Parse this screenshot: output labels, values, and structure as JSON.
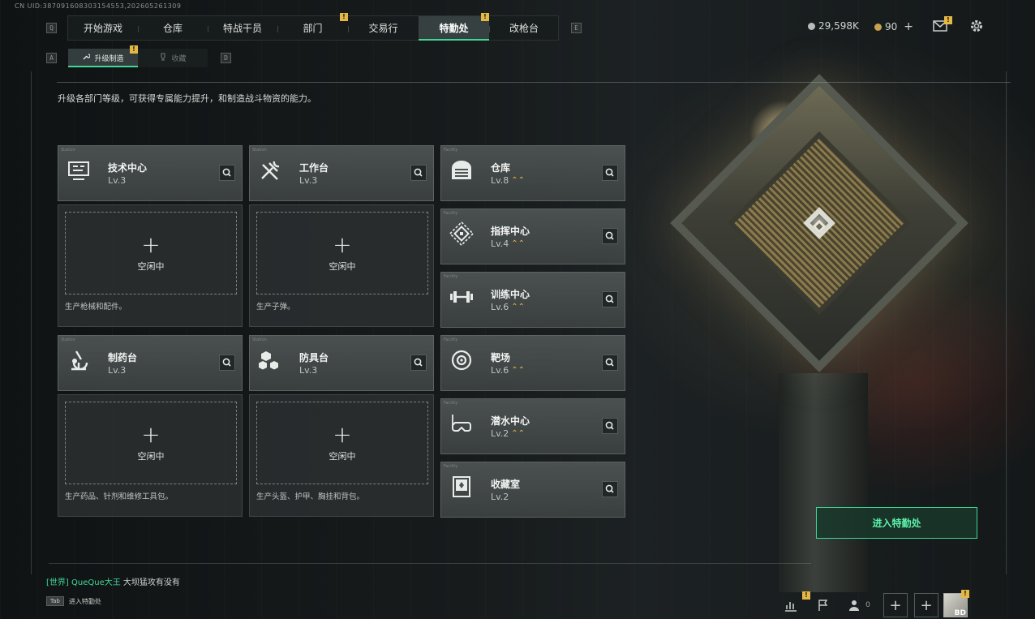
{
  "uid_text": "CN UID:387091608303154553,202605261309",
  "nav": {
    "key_left": "Q",
    "key_right": "E",
    "items": [
      {
        "label": "开始游戏",
        "badge": ""
      },
      {
        "label": "仓库",
        "badge": ""
      },
      {
        "label": "特战干员",
        "badge": ""
      },
      {
        "label": "部门",
        "badge": "!"
      },
      {
        "label": "交易行",
        "badge": ""
      },
      {
        "label": "特勤处",
        "badge": "!",
        "active": true
      },
      {
        "label": "改枪台",
        "badge": ""
      }
    ]
  },
  "resources": {
    "currency": "29,598K",
    "tokens": "90",
    "add": "+"
  },
  "header_icons": {
    "mail_badge": "!"
  },
  "subtabs": {
    "key_left": "A",
    "key_right": "D",
    "items": [
      {
        "label": "升级制造",
        "badge": "!",
        "icon": "wrench-icon"
      },
      {
        "label": "收藏",
        "badge": "",
        "icon": "trophy-icon"
      }
    ]
  },
  "description": "升级各部门等级，可获得专属能力提升，和制造战斗物资的能力。",
  "production": [
    {
      "name": "技术中心",
      "level": "Lv.3",
      "icon": "circuit-board-icon",
      "idle": "空闲中",
      "plus": "+",
      "desc": "生产枪械和配件。",
      "tiny": "Station"
    },
    {
      "name": "工作台",
      "level": "Lv.3",
      "icon": "tools-icon",
      "idle": "空闲中",
      "plus": "+",
      "desc": "生产子弹。",
      "tiny": "Station"
    },
    {
      "name": "制药台",
      "level": "Lv.3",
      "icon": "microscope-icon",
      "idle": "空闲中",
      "plus": "+",
      "desc": "生产药品、针剂和维修工具包。",
      "tiny": "Station"
    },
    {
      "name": "防具台",
      "level": "Lv.3",
      "icon": "armor-blocks-icon",
      "idle": "空闲中",
      "plus": "+",
      "desc": "生产头盔、护甲、胸挂和背包。",
      "tiny": "Station"
    }
  ],
  "facilities": [
    {
      "name": "仓库",
      "level": "Lv.8",
      "icon": "garage-icon",
      "upgrade": true,
      "tiny": "Facility"
    },
    {
      "name": "指挥中心",
      "level": "Lv.4",
      "icon": "command-chip-icon",
      "upgrade": true,
      "tiny": "Facility"
    },
    {
      "name": "训练中心",
      "level": "Lv.6",
      "icon": "dumbbell-icon",
      "upgrade": true,
      "tiny": "Facility"
    },
    {
      "name": "靶场",
      "level": "Lv.6",
      "icon": "target-icon",
      "upgrade": true,
      "tiny": "Facility"
    },
    {
      "name": "潜水中心",
      "level": "Lv.2",
      "icon": "diving-mask-icon",
      "upgrade": true,
      "tiny": "Facility"
    },
    {
      "name": "收藏室",
      "level": "Lv.2",
      "icon": "collection-case-icon",
      "upgrade": false,
      "tiny": "Facility"
    }
  ],
  "enter_button": "进入特勤处",
  "chat": {
    "channel": "[世界]",
    "name": "QueQue大王",
    "message": "大坝猛攻有没有"
  },
  "tab_hint": {
    "key": "Tab",
    "label": "进入特勤处"
  },
  "bottom": {
    "friends_count": "0",
    "avatar_level": "BD",
    "badge": "!"
  },
  "colors": {
    "accent": "#3fd896",
    "badge": "#e5b845",
    "upgrade": "#e3b54a"
  }
}
